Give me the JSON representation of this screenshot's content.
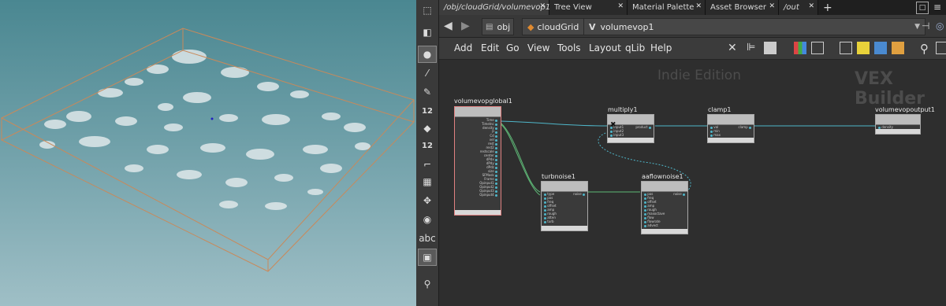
{
  "tabs": [
    {
      "label": "/obj/cloudGrid/volumevop1",
      "active": true
    },
    {
      "label": "Tree View"
    },
    {
      "label": "Material Palette"
    },
    {
      "label": "Asset Browser"
    },
    {
      "label": "/out"
    }
  ],
  "path": [
    "obj",
    "cloudGrid",
    "volumevop1"
  ],
  "menu": [
    "Add",
    "Edit",
    "Go",
    "View",
    "Tools",
    "Layout",
    "qLib",
    "Help"
  ],
  "watermark": {
    "edition": "Indie Edition",
    "context": "VEX Builder"
  },
  "tools": {
    "text_tool": "abc",
    "count_a": "12",
    "count_b": "12"
  },
  "nodes": {
    "global": {
      "name": "volumevopglobal1",
      "ports": [
        "Time",
        "TimeInc",
        "density",
        "P",
        "Cd",
        "vel",
        "rest",
        "rest2",
        "restscale",
        "center",
        "dPdx",
        "dPdy",
        "dPdz",
        "size",
        "SFMask",
        "Frame",
        "Opinput1",
        "Opinput2",
        "Opinput3",
        "Opinput4"
      ]
    },
    "multiply": {
      "name": "multiply1",
      "inputs": [
        "input1",
        "input2",
        "input3"
      ],
      "output": "product"
    },
    "clamp": {
      "name": "clamp1",
      "inputs": [
        "val",
        "min",
        "max"
      ],
      "output": "clamp"
    },
    "output": {
      "name": "volumevopoutput1",
      "inputs": [
        "density"
      ]
    },
    "turbnoise": {
      "name": "turbnoise1",
      "inputs": [
        "type",
        "pos",
        "freq",
        "offset",
        "amp",
        "rough",
        "atten",
        "turb"
      ],
      "output": "noise"
    },
    "aaflow": {
      "name": "aaflownoise1",
      "inputs": [
        "pos",
        "freq",
        "offset",
        "amp",
        "rough",
        "maxoctave",
        "flow",
        "flowrate",
        "advect"
      ],
      "output": "noise"
    }
  },
  "colors": {
    "wire": "#4fb6c9",
    "wire_green": "#5fb877",
    "bbox": "#c9895a"
  }
}
